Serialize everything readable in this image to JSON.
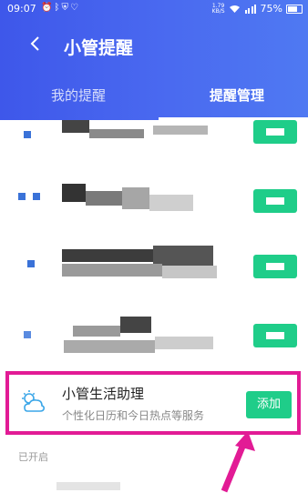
{
  "status_bar": {
    "time": "09:07",
    "icons": [
      "alarm-icon",
      "bluetooth-icon",
      "shield-icon",
      "vpn-icon"
    ],
    "net_speed_value": "1.79",
    "net_speed_unit": "KB/S",
    "battery": "75%"
  },
  "header": {
    "title": "小管提醒",
    "tabs": [
      {
        "label": "我的提醒",
        "active": false
      },
      {
        "label": "提醒管理",
        "active": true
      }
    ]
  },
  "feature": {
    "name": "小管生活助理",
    "description": "个性化日历和今日热点等服务",
    "add_label": "添加"
  },
  "section_label": "已开启",
  "colors": {
    "header": "#4a65ef",
    "accent_green": "#1fcd89",
    "highlight": "#e21b95"
  }
}
